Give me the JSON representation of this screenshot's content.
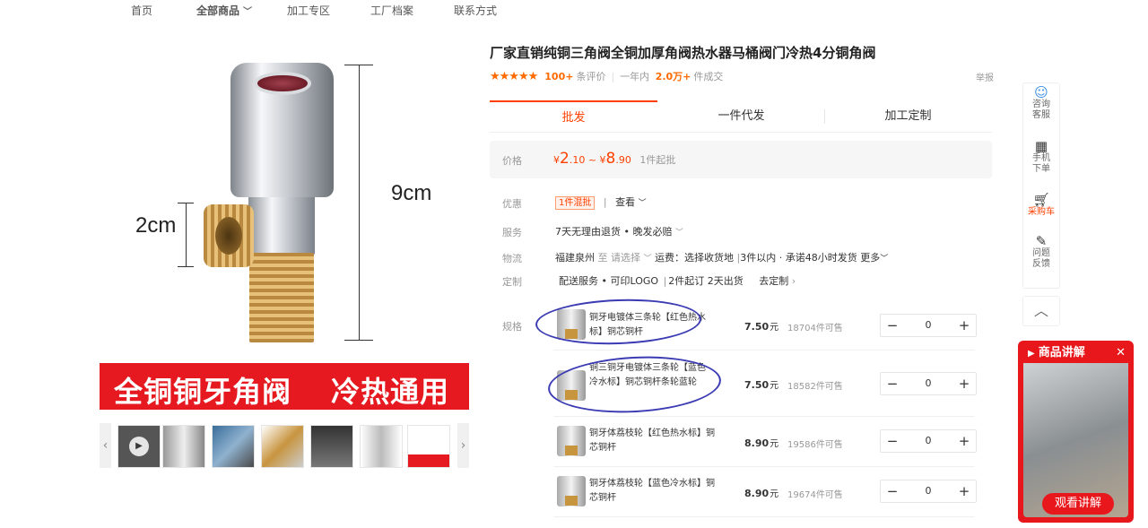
{
  "nav": {
    "items": [
      "首页",
      "全部商品",
      "加工专区",
      "工厂档案",
      "联系方式"
    ],
    "active": "全部商品"
  },
  "gallery": {
    "dim_height": "9cm",
    "dim_side": "2cm",
    "banner_left": "全铜铜牙角阀",
    "banner_right": "冷热通用",
    "thumb_count": 7
  },
  "product": {
    "title": "厂家直销纯铜三角阀全铜加厚角阀热水器马桶阀门冷热4分铜角阀",
    "stars": "★★★★★",
    "review_count": "100+",
    "review_label": "条评价",
    "year_label": "一年内",
    "sold_count": "2.0万+",
    "sold_label": "件成交",
    "report": "举报"
  },
  "tabs": [
    "批发",
    "一件代发",
    "加工定制"
  ],
  "price": {
    "label": "价格",
    "currency": "¥",
    "low_int": "2",
    "low_dec": ".10",
    "sep": "~",
    "high_int": "8",
    "high_dec": ".90",
    "min_order": "1件起批"
  },
  "promo": {
    "label": "优惠",
    "tag": "1件混批",
    "view": "查看"
  },
  "service": {
    "label": "服务",
    "text": "7天无理由退货 • 晚发必赔"
  },
  "logistics": {
    "label": "物流",
    "origin": "福建泉州",
    "to": "至 请选择",
    "fee": "运费：选择收货地",
    "delivery": "3件以内 · 承诺48小时发货",
    "more": "更多"
  },
  "custom": {
    "label": "定制",
    "service": "配送服务 • 可印LOGO",
    "moq": "2件起订",
    "days": "2天出货",
    "go": "去定制"
  },
  "spec": {
    "label": "规格",
    "unit": "元",
    "stock_suffix": "件可售",
    "items": [
      {
        "name": "铜牙电镀体三条轮【红色热水标】铜芯铜杆",
        "price": "7.50",
        "stock": "18704",
        "qty": "0"
      },
      {
        "name": "铜三铜牙电镀体三条轮【蓝色冷水标】铜芯铜杆条轮蓝轮",
        "price": "7.50",
        "stock": "18582",
        "qty": "0"
      },
      {
        "name": "铜牙体荔枝轮【红色热水标】铜芯铜杆",
        "price": "8.90",
        "stock": "19586",
        "qty": "0"
      },
      {
        "name": "铜牙体荔枝轮【蓝色冷水标】铜芯铜杆",
        "price": "8.90",
        "stock": "19674",
        "qty": "0"
      }
    ]
  },
  "sidebar": {
    "consult": "咨询客服",
    "mobile": "手机下单",
    "cart": "采购车",
    "feedback": "问题反馈"
  },
  "video": {
    "title": "商品讲解",
    "button": "观看讲解"
  },
  "colors": {
    "accent": "#ff4000",
    "banner": "#e5191f",
    "annotation": "#3b3bb3"
  }
}
